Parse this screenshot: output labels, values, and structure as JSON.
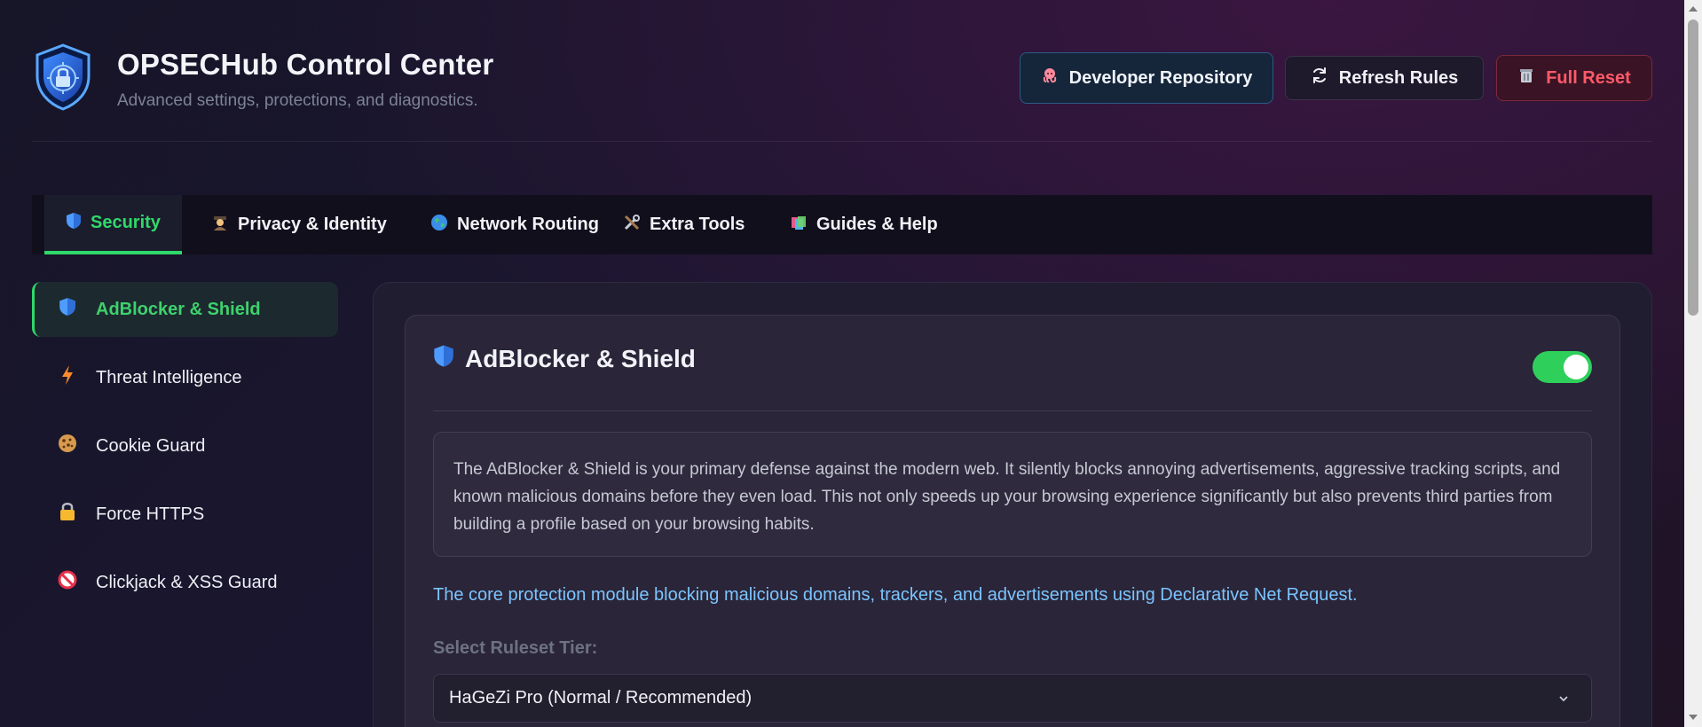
{
  "app": {
    "title": "OPSECHub Control Center",
    "subtitle": "Advanced settings, protections, and diagnostics."
  },
  "header_buttons": {
    "developer": {
      "label": "Developer Repository",
      "icon": "octopus-icon"
    },
    "refresh": {
      "label": "Refresh Rules",
      "icon": "refresh-icon"
    },
    "reset": {
      "label": "Full Reset",
      "icon": "trash-icon"
    }
  },
  "tabs": [
    {
      "label": "Security",
      "icon": "shield-icon",
      "active": true
    },
    {
      "label": "Privacy & Identity",
      "icon": "detective-icon",
      "active": false
    },
    {
      "label": "Network Routing",
      "icon": "globe-icon",
      "active": false
    },
    {
      "label": "Extra Tools",
      "icon": "tools-icon",
      "active": false
    },
    {
      "label": "Guides & Help",
      "icon": "books-icon",
      "active": false
    }
  ],
  "sidebar": {
    "items": [
      {
        "label": "AdBlocker & Shield",
        "icon": "shield-icon",
        "active": true
      },
      {
        "label": "Threat Intelligence",
        "icon": "lightning-icon",
        "active": false
      },
      {
        "label": "Cookie Guard",
        "icon": "cookie-icon",
        "active": false
      },
      {
        "label": "Force HTTPS",
        "icon": "lock-icon",
        "active": false
      },
      {
        "label": "Clickjack & XSS Guard",
        "icon": "prohibited-icon",
        "active": false
      }
    ]
  },
  "module": {
    "title": "AdBlocker & Shield",
    "enabled": true,
    "description": "The AdBlocker & Shield is your primary defense against the modern web. It silently blocks annoying advertisements, aggressive tracking scripts, and known malicious domains before they even load. This not only speeds up your browsing experience significantly but also prevents third parties from building a profile based on your browsing habits.",
    "core_text": "The core protection module blocking malicious domains, trackers, and advertisements using Declarative Net Request.",
    "select_label": "Select Ruleset Tier:",
    "select_value": "HaGeZi Pro (Normal / Recommended)"
  },
  "colors": {
    "accent_green": "#2fd96a",
    "link_blue": "#7cc4ff",
    "danger_red": "#ff5a6a"
  }
}
